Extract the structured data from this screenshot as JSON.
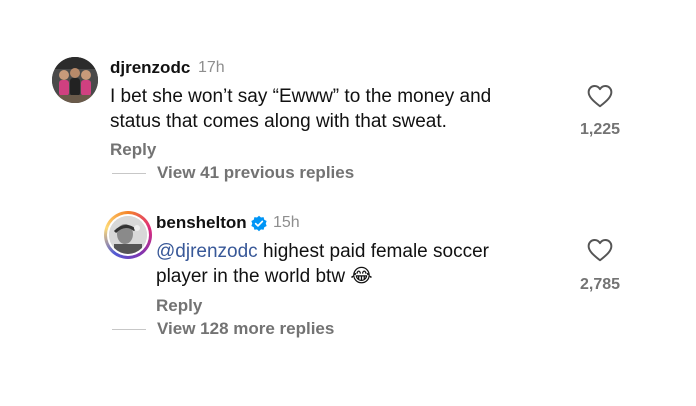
{
  "comments": [
    {
      "username": "djrenzodc",
      "time": "17h",
      "text": "I bet she won’t say “Ewww” to the money and status that comes along with that sweat.",
      "like_count": "1,225",
      "reply_label": "Reply",
      "view_replies_label": "View 41 previous replies",
      "verified": false
    },
    {
      "username": "benshelton",
      "time": "15h",
      "mention": "@djrenzodc",
      "text": " highest paid female soccer player in the world btw ",
      "emoji": "😂",
      "like_count": "2,785",
      "reply_label": "Reply",
      "view_replies_label": "View 128 more replies",
      "verified": true
    }
  ],
  "icons": {
    "like": "heart-outline-icon",
    "verified": "verified-badge-icon"
  },
  "colors": {
    "mention": "#385898",
    "verified": "#0095f6",
    "muted": "#737373"
  }
}
